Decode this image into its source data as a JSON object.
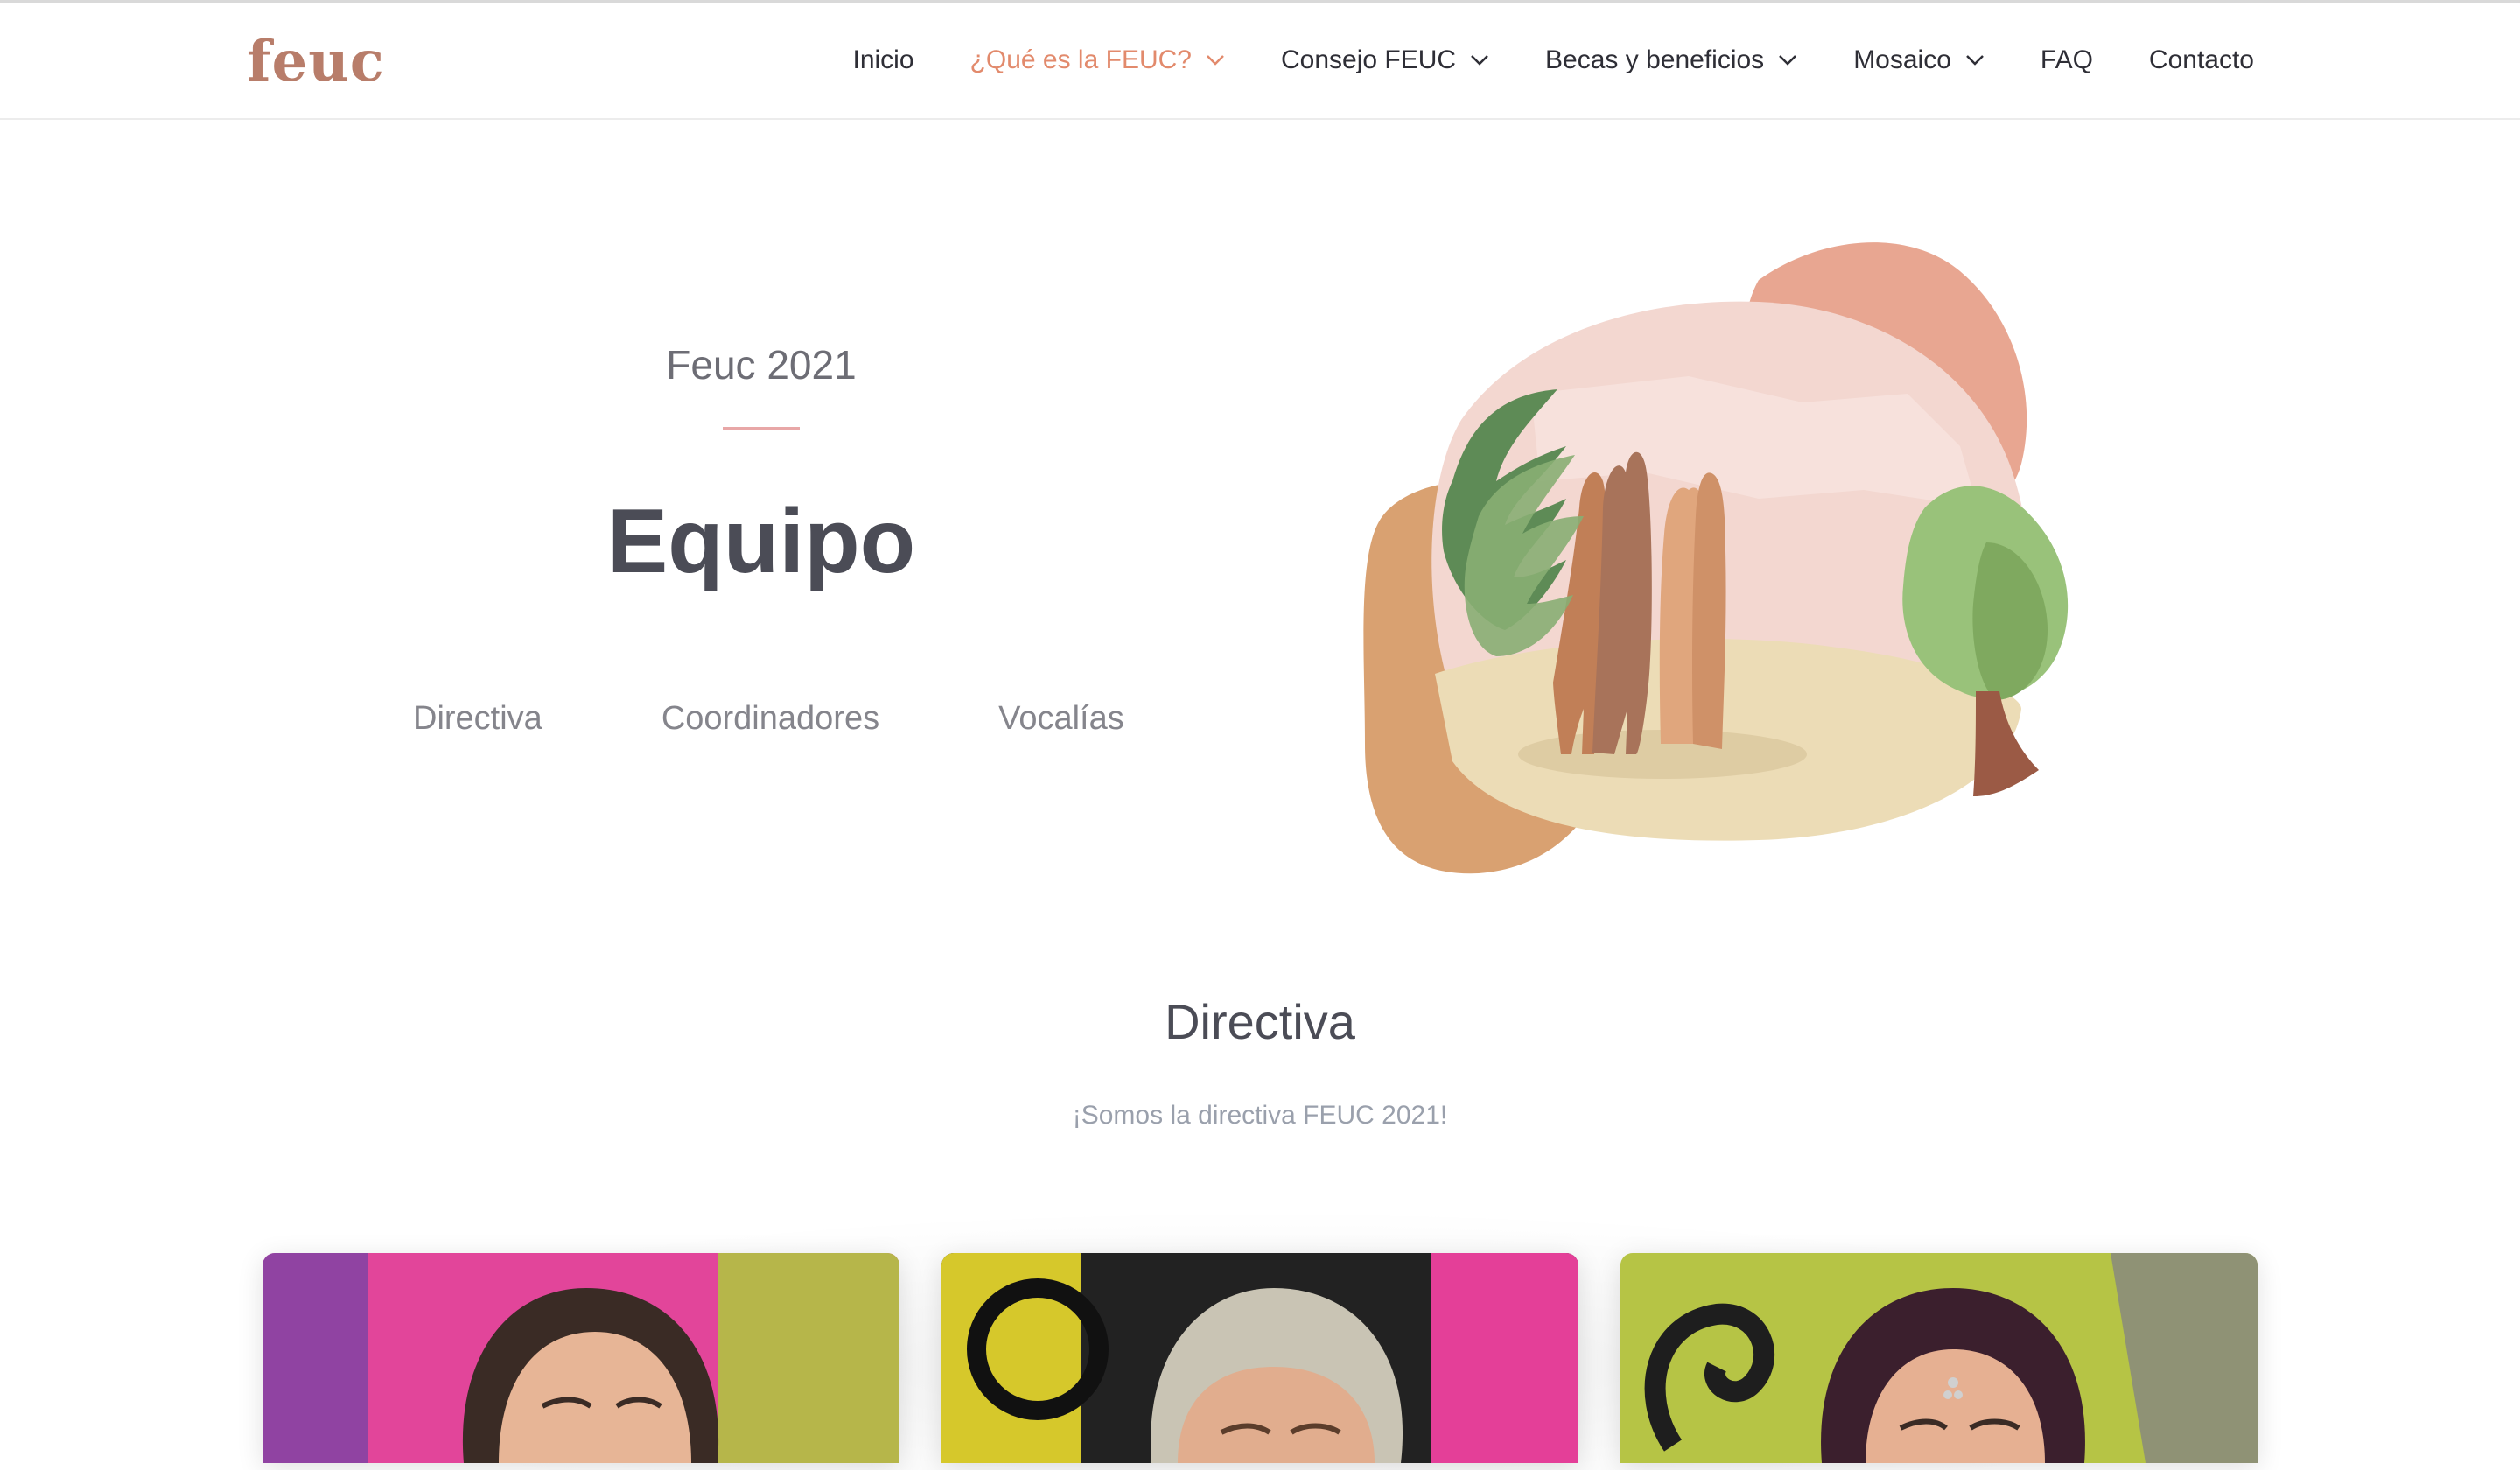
{
  "brand": {
    "logo_text": "feuc"
  },
  "nav": {
    "items": [
      {
        "label": "Inicio",
        "dropdown": false,
        "active": false
      },
      {
        "label": "¿Qué es la FEUC?",
        "dropdown": true,
        "active": true
      },
      {
        "label": "Consejo FEUC",
        "dropdown": true,
        "active": false
      },
      {
        "label": "Becas y beneficios",
        "dropdown": true,
        "active": false
      },
      {
        "label": "Mosaico",
        "dropdown": true,
        "active": false
      },
      {
        "label": "FAQ",
        "dropdown": false,
        "active": false
      },
      {
        "label": "Contacto",
        "dropdown": false,
        "active": false
      }
    ],
    "active_color": "#e28a6c"
  },
  "hero": {
    "eyebrow": "Feuc 2021",
    "title": "Equipo",
    "tabs": [
      "Directiva",
      "Coordinadores",
      "Vocalías"
    ]
  },
  "section": {
    "title": "Directiva",
    "subtitle": "¡Somos la directiva FEUC 2021!"
  },
  "icons": {
    "chevron": "chevron-down-icon",
    "illustration": "team-people-illustration"
  },
  "colors": {
    "brand": "#b87d6a",
    "accent_line": "#e8a7a7",
    "heading": "#4b4c56"
  }
}
